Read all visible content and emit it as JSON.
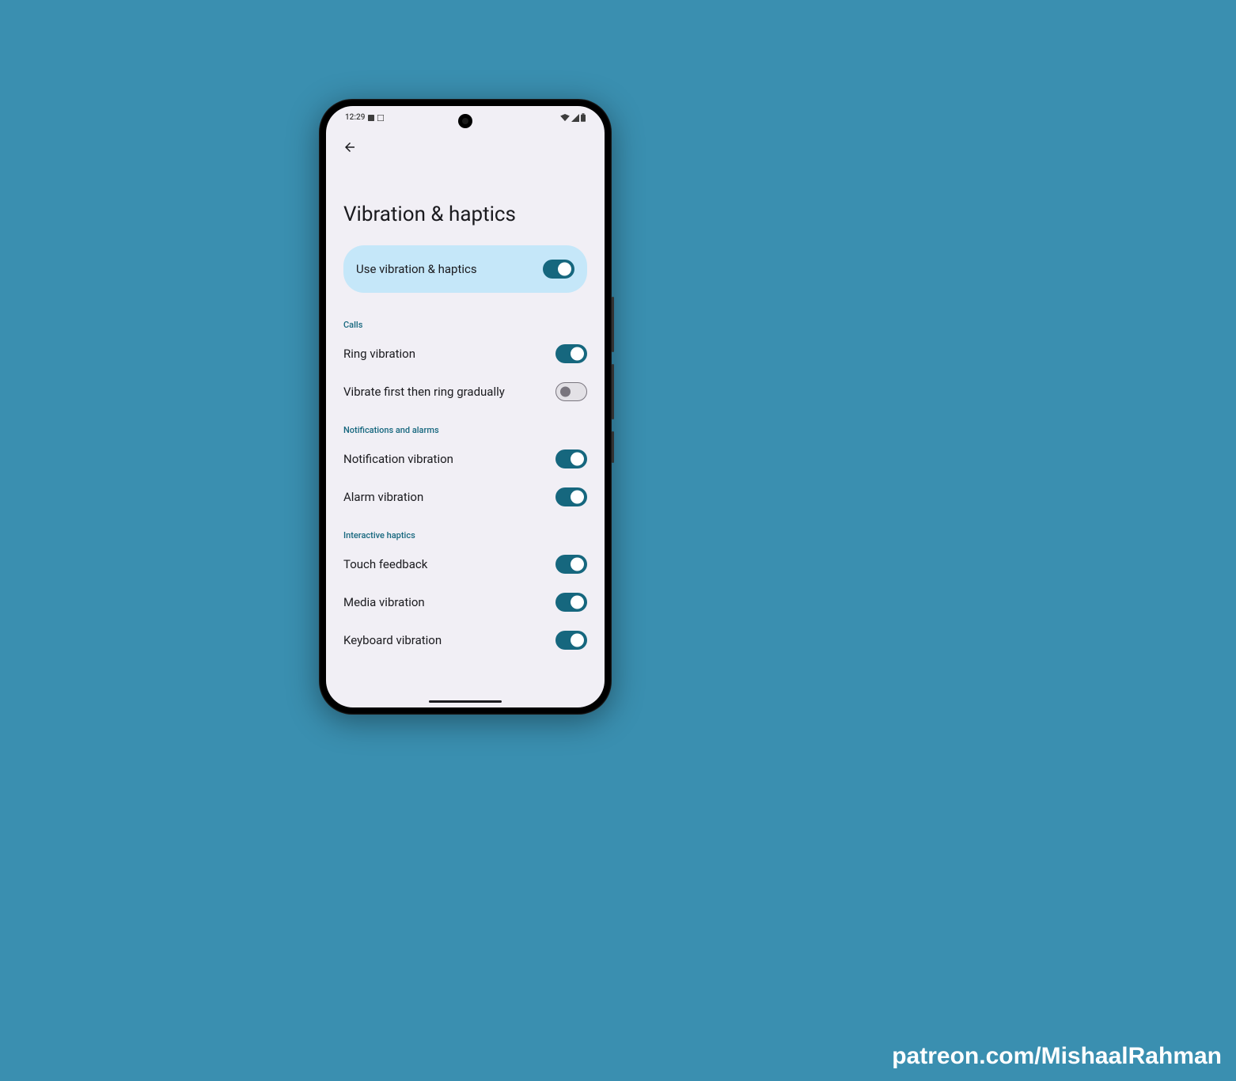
{
  "statusBar": {
    "time": "12:29"
  },
  "pageTitle": "Vibration & haptics",
  "masterToggle": {
    "label": "Use vibration & haptics",
    "enabled": true
  },
  "sections": [
    {
      "header": "Calls",
      "items": [
        {
          "label": "Ring vibration",
          "enabled": true
        },
        {
          "label": "Vibrate first then ring gradually",
          "enabled": false
        }
      ]
    },
    {
      "header": "Notifications and alarms",
      "items": [
        {
          "label": "Notification vibration",
          "enabled": true
        },
        {
          "label": "Alarm vibration",
          "enabled": true
        }
      ]
    },
    {
      "header": "Interactive haptics",
      "items": [
        {
          "label": "Touch feedback",
          "enabled": true
        },
        {
          "label": "Media vibration",
          "enabled": true
        },
        {
          "label": "Keyboard vibration",
          "enabled": true
        }
      ]
    }
  ],
  "watermark": "patreon.com/MishaalRahman"
}
